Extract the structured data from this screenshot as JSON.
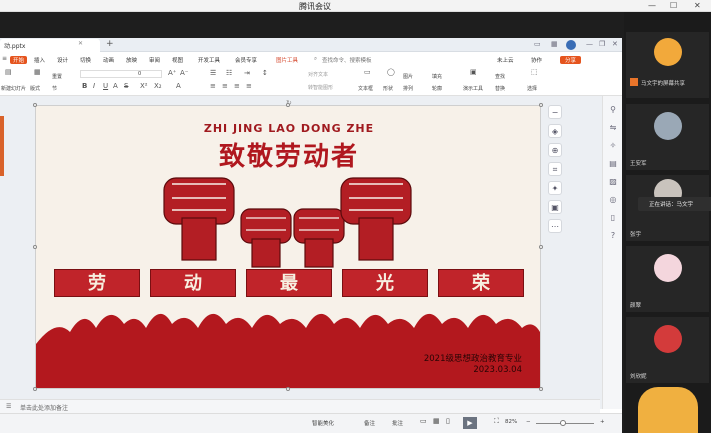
{
  "meeting": {
    "title": "腾讯会议"
  },
  "file_tab": {
    "name": "动.pptx"
  },
  "ribbon_tabs": [
    "开始",
    "插入",
    "设计",
    "切换",
    "动画",
    "放映",
    "审阅",
    "视图",
    "开发工具",
    "会员专享",
    "图片工具"
  ],
  "search": {
    "placeholder": "查找命令、搜索模板"
  },
  "header_right": {
    "cloud": "未上云",
    "collab": "协作",
    "share": "分享"
  },
  "toolbar": {
    "new_slide": "新建幻灯片",
    "layout": "版式",
    "section": "节",
    "reset": "重置",
    "font_size": "0",
    "text_box": "文本框",
    "shape": "形状",
    "arrange": "排列",
    "picture": "图片",
    "fill": "填充",
    "outline": "轮廓",
    "presenter": "演示工具",
    "find": "查找",
    "replace": "替换",
    "select": "选择",
    "to_smartart": "转智能图形",
    "align_text": "对齐文本"
  },
  "slide": {
    "pinyin": "ZHI JING LAO DONG ZHE",
    "headline": "致敬劳动者",
    "banners": [
      "劳",
      "动",
      "最",
      "光",
      "荣"
    ],
    "org": "2021级思想政治教育专业",
    "date": "2023.03.04"
  },
  "notes": {
    "placeholder": "单击此处添加备注"
  },
  "status": {
    "smart_beautify": "智能美化",
    "notes": "备注",
    "comments": "批注",
    "zoom": "82%"
  },
  "participants": [
    {
      "name": "马文宇的屏幕共享",
      "color": "#d04a2a"
    },
    {
      "name": "王安军",
      "color": "#9aa8b6"
    },
    {
      "name": "张宇",
      "color": "#c9c3bd"
    },
    {
      "name": "颜翠",
      "color": "#f4d6dd"
    },
    {
      "name": "刘欣妮",
      "color": "#d33b3b"
    }
  ],
  "speaking": {
    "text": "正在讲话：马文宇"
  },
  "colors": {
    "accent": "#e5541e",
    "slide_red": "#b0181f",
    "slide_bg": "#f7f1e9"
  }
}
